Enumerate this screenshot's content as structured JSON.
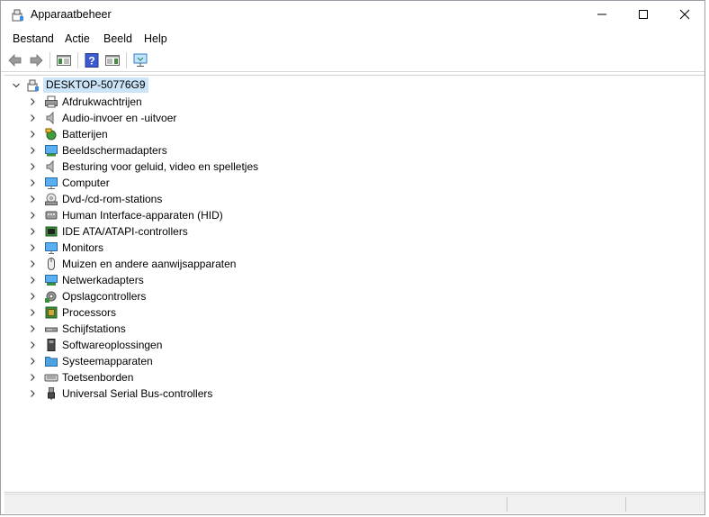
{
  "window": {
    "title": "Apparaatbeheer",
    "caption_icons": [
      "minimize-icon",
      "maximize-icon",
      "close-icon"
    ]
  },
  "menu": {
    "items": [
      "Bestand",
      "Actie",
      "Beeld",
      "Help"
    ]
  },
  "toolbar": {
    "icons": [
      "back-arrow-icon",
      "forward-arrow-icon",
      "properties-pane-icon",
      "help-icon",
      "action-pane-icon",
      "monitor-network-icon"
    ]
  },
  "tree": {
    "root": {
      "label": "DESKTOP-50776G9",
      "icon": "computer-root-icon",
      "expanded": true
    },
    "categories": [
      {
        "label": "Afdrukwachtrijen",
        "icon": "printer-icon"
      },
      {
        "label": "Audio-invoer en -uitvoer",
        "icon": "speaker-icon"
      },
      {
        "label": "Batterijen",
        "icon": "battery-icon"
      },
      {
        "label": "Beeldschermadapters",
        "icon": "display-adapter-icon"
      },
      {
        "label": "Besturing voor geluid, video en spelletjes",
        "icon": "sound-video-icon"
      },
      {
        "label": "Computer",
        "icon": "computer-icon"
      },
      {
        "label": "Dvd-/cd-rom-stations",
        "icon": "dvd-drive-icon"
      },
      {
        "label": "Human Interface-apparaten (HID)",
        "icon": "hid-icon"
      },
      {
        "label": "IDE ATA/ATAPI-controllers",
        "icon": "ide-controller-icon"
      },
      {
        "label": "Monitors",
        "icon": "monitor-icon"
      },
      {
        "label": "Muizen en andere aanwijsapparaten",
        "icon": "mouse-icon"
      },
      {
        "label": "Netwerkadapters",
        "icon": "network-adapter-icon"
      },
      {
        "label": "Opslagcontrollers",
        "icon": "storage-controller-icon"
      },
      {
        "label": "Processors",
        "icon": "processor-icon"
      },
      {
        "label": "Schijfstations",
        "icon": "disk-drive-icon"
      },
      {
        "label": "Softwareoplossingen",
        "icon": "software-component-icon"
      },
      {
        "label": "Systeemapparaten",
        "icon": "system-devices-icon"
      },
      {
        "label": "Toetsenborden",
        "icon": "keyboard-icon"
      },
      {
        "label": "Universal Serial Bus-controllers",
        "icon": "usb-icon"
      }
    ]
  },
  "colors": {
    "selection": "#cce4f7",
    "accent": "#1a73c9"
  }
}
